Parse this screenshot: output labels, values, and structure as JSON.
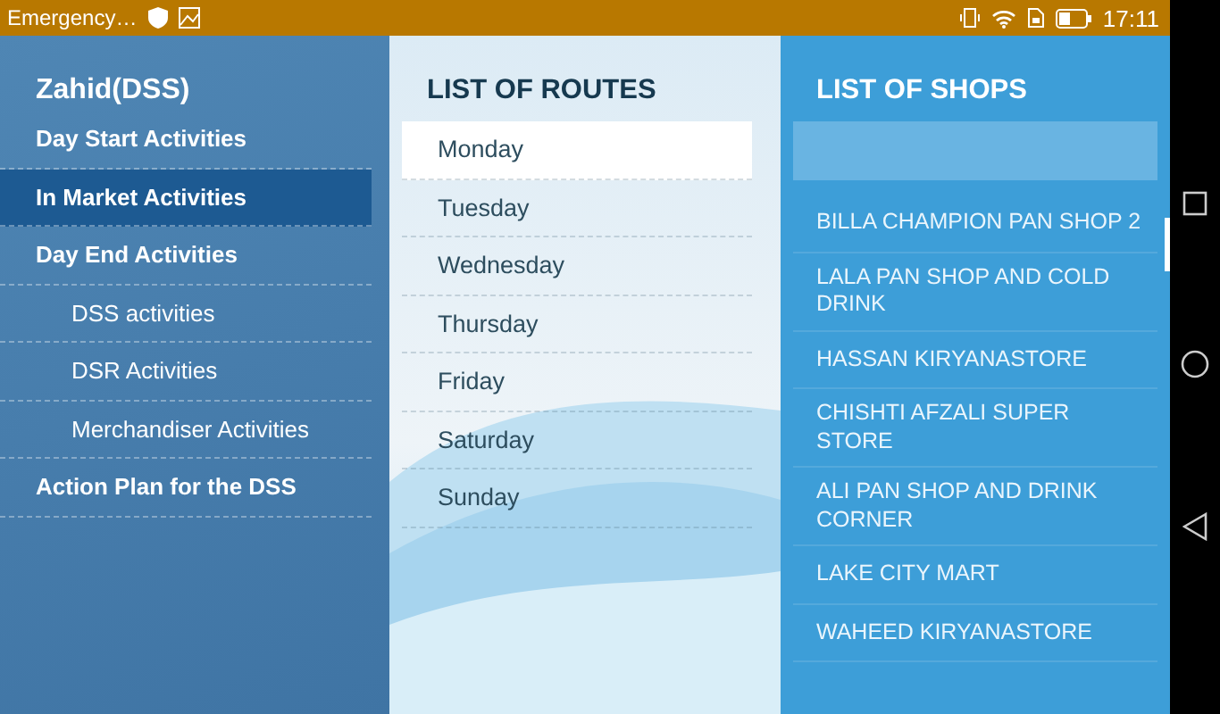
{
  "status_bar": {
    "notification": "Emergency…",
    "time": "17:11"
  },
  "sidebar": {
    "title": "Zahid(DSS)",
    "items": [
      {
        "label": "Day Start Activities",
        "kind": "section",
        "selected": false
      },
      {
        "label": "In Market Activities",
        "kind": "section",
        "selected": true
      },
      {
        "label": "Day End Activities",
        "kind": "section",
        "selected": false
      },
      {
        "label": "DSS activities",
        "kind": "sub",
        "selected": false
      },
      {
        "label": "DSR Activities",
        "kind": "sub",
        "selected": false
      },
      {
        "label": "Merchandiser Activities",
        "kind": "sub",
        "selected": false
      },
      {
        "label": "Action Plan for the DSS",
        "kind": "section",
        "selected": false
      }
    ]
  },
  "routes": {
    "title": "LIST OF ROUTES",
    "items": [
      {
        "label": "Monday",
        "selected": true
      },
      {
        "label": "Tuesday",
        "selected": false
      },
      {
        "label": "Wednesday",
        "selected": false
      },
      {
        "label": "Thursday",
        "selected": false
      },
      {
        "label": "Friday",
        "selected": false
      },
      {
        "label": "Saturday",
        "selected": false
      },
      {
        "label": "Sunday",
        "selected": false
      }
    ]
  },
  "shops": {
    "title": "LIST OF SHOPS",
    "items": [
      "BILLA CHAMPION PAN SHOP 2",
      "LALA PAN SHOP AND COLD DRINK",
      "HASSAN KIRYANASTORE",
      "CHISHTI AFZALI SUPER STORE",
      "ALI PAN SHOP AND DRINK CORNER",
      "LAKE CITY MART",
      "WAHEED KIRYANASTORE"
    ]
  }
}
